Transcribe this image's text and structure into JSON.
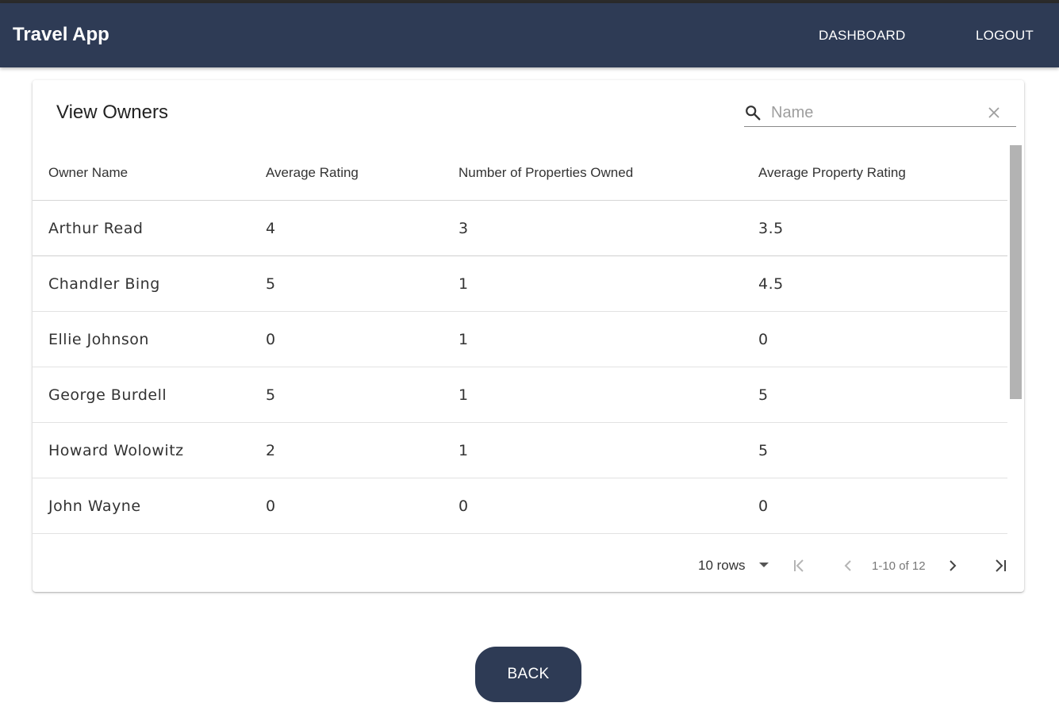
{
  "appbar": {
    "title": "Travel App",
    "dashboard_label": "DASHBOARD",
    "logout_label": "LOGOUT",
    "bg_color": "#2e3b55"
  },
  "card": {
    "title": "View Owners",
    "search": {
      "placeholder": "Name",
      "value": ""
    }
  },
  "table": {
    "headers": [
      "Owner Name",
      "Average Rating",
      "Number of Properties Owned",
      "Average Property Rating"
    ],
    "rows": [
      [
        "Arthur Read",
        "4",
        "3",
        "3.5"
      ],
      [
        "Chandler Bing",
        "5",
        "1",
        "4.5"
      ],
      [
        "Ellie Johnson",
        "0",
        "1",
        "0"
      ],
      [
        "George Burdell",
        "5",
        "1",
        "5"
      ],
      [
        "Howard Wolowitz",
        "2",
        "1",
        "5"
      ],
      [
        "John Wayne",
        "0",
        "0",
        "0"
      ]
    ]
  },
  "pagination": {
    "rows_per_page": "10 rows",
    "range": "1-10 of 12",
    "icons": [
      "first-page-icon",
      "previous-page-icon",
      "next-page-icon",
      "last-page-icon"
    ]
  },
  "back_button": {
    "label": "BACK"
  }
}
